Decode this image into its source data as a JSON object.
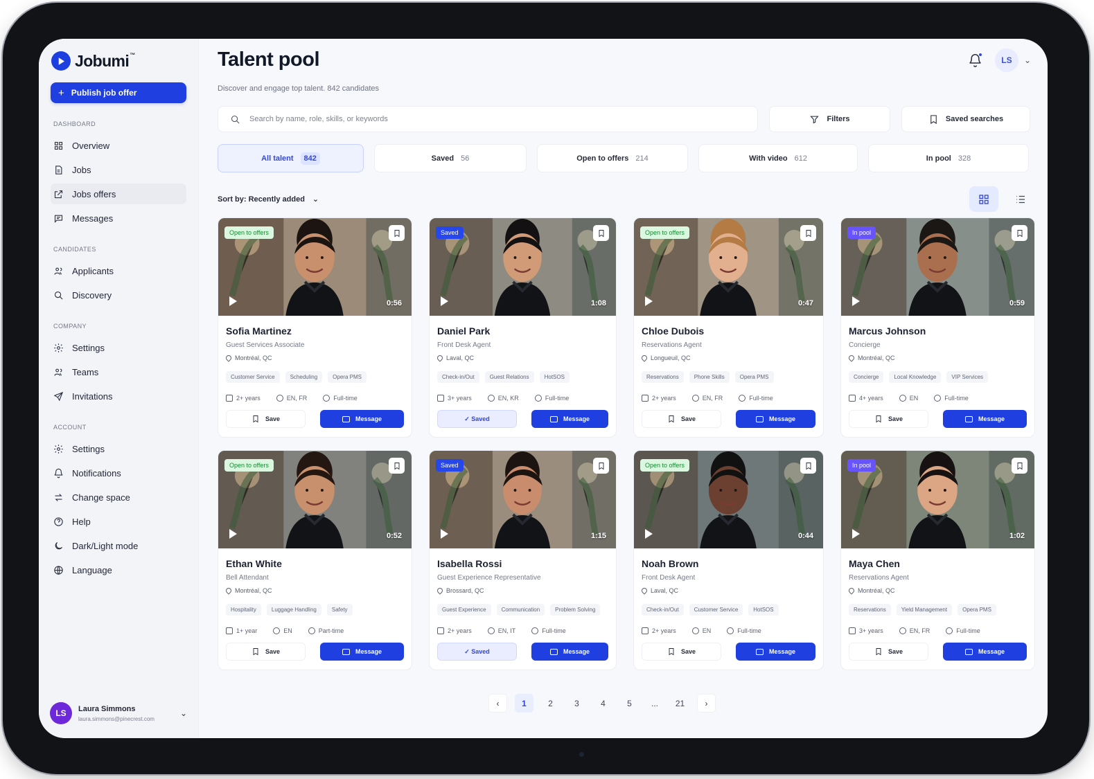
{
  "app": {
    "brand": "Jobumi",
    "trademark": "™",
    "publish": "Publish job offer"
  },
  "sidebar": {
    "sections": [
      {
        "title": "DASHBOARD",
        "items": [
          {
            "label": "Overview",
            "icon": "grid-icon"
          },
          {
            "label": "Jobs",
            "icon": "document-icon"
          },
          {
            "label": "Jobs offers",
            "icon": "external-link-icon",
            "active": true
          },
          {
            "label": "Messages",
            "icon": "message-icon"
          }
        ]
      },
      {
        "title": "CANDIDATES",
        "items": [
          {
            "label": "Applicants",
            "icon": "users-icon"
          },
          {
            "label": "Discovery",
            "icon": "search-icon"
          }
        ]
      },
      {
        "title": "COMPANY",
        "items": [
          {
            "label": "Settings",
            "icon": "gear-icon"
          },
          {
            "label": "Teams",
            "icon": "users-icon"
          },
          {
            "label": "Invitations",
            "icon": "send-icon"
          }
        ]
      },
      {
        "title": "ACCOUNT",
        "items": [
          {
            "label": "Settings",
            "icon": "gear-icon"
          },
          {
            "label": "Notifications",
            "icon": "bell-icon"
          },
          {
            "label": "Change space",
            "icon": "swap-icon"
          },
          {
            "label": "Help",
            "icon": "help-icon"
          },
          {
            "label": "Dark/Light mode",
            "icon": "moon-icon"
          },
          {
            "label": "Language",
            "icon": "globe-icon"
          }
        ]
      }
    ],
    "user": {
      "initials": "LS",
      "name": "Laura Simmons",
      "email": "laura.simmons@pinecrest.com"
    }
  },
  "header": {
    "title": "Talent pool",
    "subtitle": "Discover and engage top talent. 842 candidates",
    "user_initials": "LS"
  },
  "search": {
    "placeholder": "Search by name, role, skills, or keywords"
  },
  "toolbar": {
    "filters": "Filters",
    "saved_searches": "Saved searches"
  },
  "tabs": [
    {
      "label": "All talent",
      "count": "842",
      "active": true
    },
    {
      "label": "Saved",
      "count": "56"
    },
    {
      "label": "Open to offers",
      "count": "214"
    },
    {
      "label": "With video",
      "count": "612"
    },
    {
      "label": "In pool",
      "count": "328"
    }
  ],
  "sort": {
    "label": "Sort by: Recently added"
  },
  "cards": [
    {
      "name": "Sofia Martinez",
      "role": "Guest Services Associate",
      "location": "Montréal, QC",
      "badge": "Open to offers",
      "badge_type": "open",
      "duration": "0:56",
      "skills": [
        "Customer Service",
        "Scheduling",
        "Opera PMS"
      ],
      "experience": "2+ years",
      "languages": "EN, FR",
      "type": "Full-time",
      "save": "Save",
      "message": "Message",
      "saved": false,
      "bg": "#9b8b78",
      "skin": "#c9906e",
      "hair": "#1b1411"
    },
    {
      "name": "Daniel Park",
      "role": "Front Desk Agent",
      "location": "Laval, QC",
      "badge": "Saved",
      "badge_type": "saved",
      "duration": "1:08",
      "skills": [
        "Check-in/Out",
        "Guest Relations",
        "HotSOS"
      ],
      "experience": "3+ years",
      "languages": "EN, KR",
      "type": "Full-time",
      "save": "✓ Saved",
      "message": "Message",
      "saved": true,
      "bg": "#8d8b82",
      "skin": "#d29b77",
      "hair": "#131112"
    },
    {
      "name": "Chloe Dubois",
      "role": "Reservations Agent",
      "location": "Longueuil, QC",
      "badge": "Open to offers",
      "badge_type": "open",
      "duration": "0:47",
      "skills": [
        "Reservations",
        "Phone Skills",
        "Opera PMS"
      ],
      "experience": "2+ years",
      "languages": "EN, FR",
      "type": "Full-time",
      "save": "Save",
      "message": "Message",
      "saved": false,
      "bg": "#a09584",
      "skin": "#e2b08f",
      "hair": "#b47b45"
    },
    {
      "name": "Marcus Johnson",
      "role": "Concierge",
      "location": "Montréal, QC",
      "badge": "In pool",
      "badge_type": "pool",
      "duration": "0:59",
      "skills": [
        "Concierge",
        "Local Knowledge",
        "VIP Services"
      ],
      "experience": "4+ years",
      "languages": "EN",
      "type": "Full-time",
      "save": "Save",
      "message": "Message",
      "saved": false,
      "bg": "#878f8b",
      "skin": "#a96f4f",
      "hair": "#1a1715"
    },
    {
      "name": "Ethan White",
      "role": "Bell Attendant",
      "location": "Montréal, QC",
      "badge": "Open to offers",
      "badge_type": "open",
      "duration": "0:52",
      "skills": [
        "Hospitality",
        "Luggage Handling",
        "Safety"
      ],
      "experience": "1+ year",
      "languages": "EN",
      "type": "Part-time",
      "save": "Save",
      "message": "Message",
      "saved": false,
      "bg": "#81827d",
      "skin": "#c8906d",
      "hair": "#241711"
    },
    {
      "name": "Isabella Rossi",
      "role": "Guest Experience Representative",
      "location": "Brossard, QC",
      "badge": "Saved",
      "badge_type": "saved",
      "duration": "1:15",
      "skills": [
        "Guest Experience",
        "Communication",
        "Problem Solving"
      ],
      "experience": "2+ years",
      "languages": "EN, IT",
      "type": "Full-time",
      "save": "✓ Saved",
      "message": "Message",
      "saved": true,
      "bg": "#9a8d7e",
      "skin": "#c98d6d",
      "hair": "#1c1410"
    },
    {
      "name": "Noah Brown",
      "role": "Front Desk Agent",
      "location": "Laval, QC",
      "badge": "Open to offers",
      "badge_type": "open",
      "duration": "0:44",
      "skills": [
        "Check-in/Out",
        "Customer Service",
        "HotSOS"
      ],
      "experience": "2+ years",
      "languages": "EN",
      "type": "Full-time",
      "save": "Save",
      "message": "Message",
      "saved": false,
      "bg": "#6f7879",
      "skin": "#6b4030",
      "hair": "#111111"
    },
    {
      "name": "Maya Chen",
      "role": "Reservations Agent",
      "location": "Montréal, QC",
      "badge": "In pool",
      "badge_type": "pool",
      "duration": "1:02",
      "skills": [
        "Reservations",
        "Yield Management",
        "Opera PMS"
      ],
      "experience": "3+ years",
      "languages": "EN, FR",
      "type": "Full-time",
      "save": "Save",
      "message": "Message",
      "saved": false,
      "bg": "#7e867a",
      "skin": "#dca584",
      "hair": "#171211"
    }
  ],
  "pagination": {
    "prev": "‹",
    "pages": [
      "1",
      "2",
      "3",
      "4",
      "5",
      "...",
      "21"
    ],
    "active": "1",
    "next": "›"
  }
}
